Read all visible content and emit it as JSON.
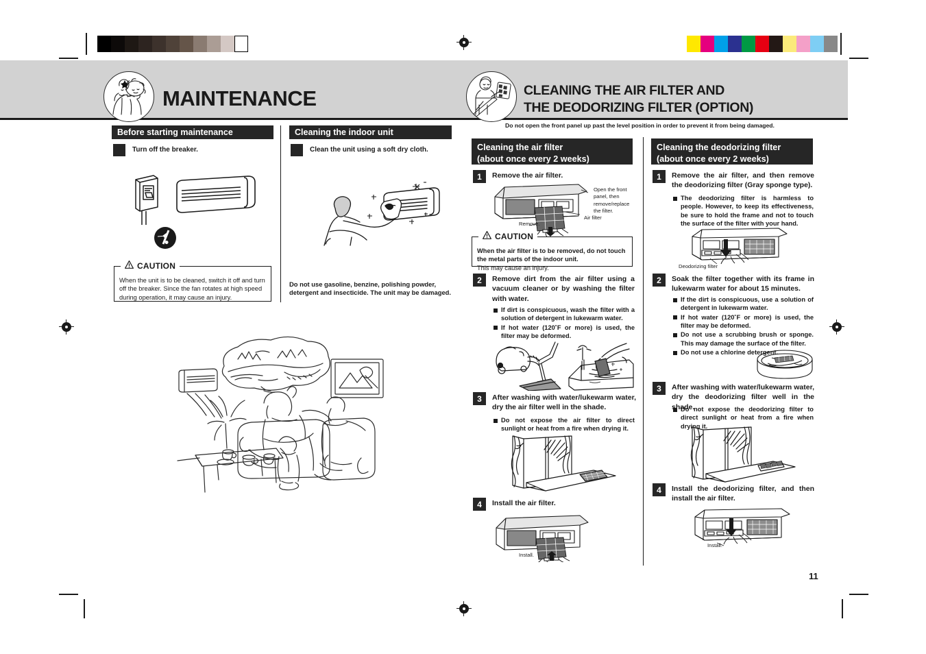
{
  "page": {
    "number": "11",
    "colors": {
      "band": "#d2d2d2",
      "bar_black": "#262626",
      "ink": "#1a1a1a"
    }
  },
  "calibration": {
    "grayscale_swatches": [
      "#000000",
      "#0d0a09",
      "#1e1814",
      "#2d2420",
      "#3d322c",
      "#4f4239",
      "#655549",
      "#8a7b71",
      "#ab9d95",
      "#d4c8c4",
      "#ffffff"
    ],
    "color_swatches": [
      "#ffe800",
      "#e5007e",
      "#00a0e9",
      "#2b3190",
      "#009944",
      "#e60012",
      "#231815",
      "#fbea7b",
      "#f4a0c8",
      "#7ecef4",
      "#898989"
    ]
  },
  "headers": {
    "left": {
      "title": "MAINTENANCE",
      "icon": "family-maintenance-icon"
    },
    "right": {
      "title_line1": "CLEANING THE AIR FILTER AND",
      "title_line2": "THE DEODORIZING FILTER (OPTION)",
      "icon": "technician-filter-icon"
    }
  },
  "maintenance": {
    "note_top": "Do not open the front panel up past the level position in order to prevent it from being damaged.",
    "before": {
      "bar": "Before starting maintenance",
      "step_label": "Turn off the breaker.",
      "caution": {
        "title": "CAUTION",
        "text": "When the unit is to be cleaned, switch it off and turn off the breaker. Since the fan rotates at high speed during operation, it may cause an injury."
      }
    },
    "indoor": {
      "bar": "Cleaning the indoor unit",
      "step_label": "Clean the unit using a soft dry cloth.",
      "note": "Do not use gasoline, benzine, polishing powder, detergent and insecticide. The unit may be damaged."
    }
  },
  "air_filter": {
    "bar_line1": "Cleaning the air filter",
    "bar_line2": "(about once every 2 weeks)",
    "steps": [
      {
        "num": "1",
        "title": "Remove the air filter.",
        "bullets": [],
        "callouts": [
          "Open the front panel, then remove/replace the filter.",
          "Air filter",
          "Remove."
        ]
      },
      {
        "num": "2",
        "title": "Remove dirt from the air filter using a vacuum cleaner or by washing the filter with water.",
        "bullets": [
          "If dirt is conspicuous, wash the filter with a solution of detergent in lukewarm water.",
          "If hot water (120˚F or more) is used, the filter may be deformed."
        ],
        "callouts": []
      },
      {
        "num": "3",
        "title": "After washing with water/lukewarm water, dry the air filter well in the shade.",
        "bullets": [
          "Do not expose the air filter to direct sunlight or heat from a fire when drying it."
        ],
        "callouts": []
      },
      {
        "num": "4",
        "title": "Install the air filter.",
        "bullets": [],
        "callouts": [
          "Install."
        ]
      }
    ],
    "caution": {
      "title": "CAUTION",
      "bold_text": "When the air filter is to be removed, do not touch the metal parts of the indoor unit.",
      "plain_text": "This may cause an injury."
    }
  },
  "deodorizing_filter": {
    "bar_line1": "Cleaning the deodorizing filter",
    "bar_line2": "(about once every 2 weeks)",
    "steps": [
      {
        "num": "1",
        "title": "Remove the air filter, and then remove the deodorizing filter (Gray sponge type).",
        "bullets": [
          "The deodorizing filter is harmless to people. However, to keep its effectiveness, be sure to hold the frame and not to touch the surface of the filter with your hand."
        ],
        "callouts": [
          "Deodorizing filter"
        ]
      },
      {
        "num": "2",
        "title": "Soak the filter together with its frame in lukewarm water for about 15 minutes.",
        "bullets": [
          "If the dirt is conspicuous, use a solution of detergent in lukewarm water.",
          "If hot water (120˚F or more) is used, the filter may be deformed.",
          "Do not use a scrubbing brush or sponge. This may damage the surface of the filter.",
          "Do not use a chlorine detergent."
        ],
        "callouts": []
      },
      {
        "num": "3",
        "title": "After washing with water/lukewarm water, dry the deodorizing filter well in the shade.",
        "bullets": [
          "Do not expose the deodorizing filter to direct sunlight or heat from a fire when drying it."
        ],
        "callouts": []
      },
      {
        "num": "4",
        "title": "Install the deodorizing filter, and then install the air filter.",
        "bullets": [],
        "callouts": [
          "Install."
        ]
      }
    ]
  }
}
